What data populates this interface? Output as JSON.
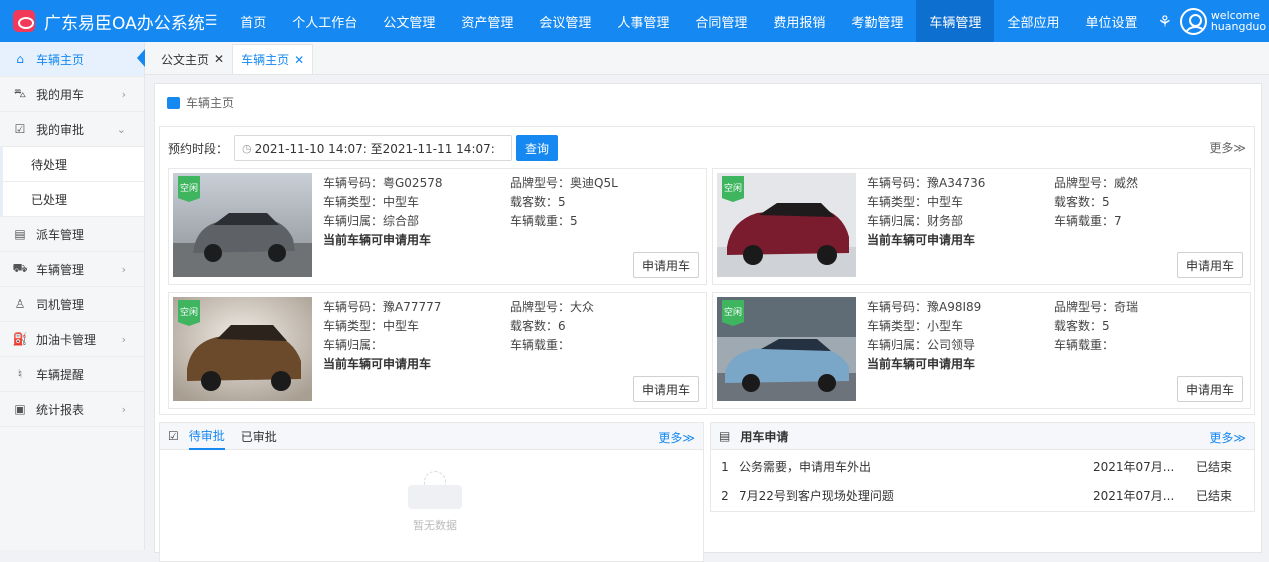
{
  "header": {
    "app_title": "广东易臣OA办公系统",
    "nav": [
      "首页",
      "个人工作台",
      "公文管理",
      "资产管理",
      "会议管理",
      "人事管理",
      "合同管理",
      "费用报销",
      "考勤管理",
      "车辆管理",
      "全部应用",
      "单位设置"
    ],
    "active_nav": "车辆管理",
    "user_line1": "welcome",
    "user_line2": "huangduo",
    "brand_color": "#1688f2"
  },
  "sidebar": {
    "items": [
      {
        "label": "车辆主页",
        "icon": "home-icon"
      },
      {
        "label": "我的用车",
        "icon": "car-icon"
      },
      {
        "label": "我的审批",
        "icon": "checkbox-icon"
      },
      {
        "label": "待处理"
      },
      {
        "label": "已处理"
      },
      {
        "label": "派车管理",
        "icon": "dispatch-icon"
      },
      {
        "label": "车辆管理",
        "icon": "car-manage-icon"
      },
      {
        "label": "司机管理",
        "icon": "driver-icon"
      },
      {
        "label": "加油卡管理",
        "icon": "fuel-card-icon"
      },
      {
        "label": "车辆提醒",
        "icon": "bell-icon"
      },
      {
        "label": "统计报表",
        "icon": "report-icon"
      }
    ]
  },
  "tabs": [
    {
      "label": "公文主页"
    },
    {
      "label": "车辆主页"
    }
  ],
  "breadcrumb": "车辆主页",
  "filter": {
    "label": "预约时段：",
    "date_range": "2021-11-10 14:07: 至2021-11-11 14:07:",
    "query_button": "查询",
    "more": "更多≫"
  },
  "cars": [
    {
      "badge": "空闲",
      "plate": "车辆号码：粤G02578",
      "brand": "品牌型号：奥迪Q5L",
      "type": "车辆类型：中型车",
      "seats": "载客数：5",
      "owner": "车辆归属：综合部",
      "load": "车辆载重：5",
      "status": "当前车辆可申请用车",
      "apply": "申请用车",
      "color": "#7a7c80"
    },
    {
      "badge": "空闲",
      "plate": "车辆号码：豫A34736",
      "brand": "品牌型号：威然",
      "type": "车辆类型：中型车",
      "seats": "载客数：5",
      "owner": "车辆归属：财务部",
      "load": "车辆载重：7",
      "status": "当前车辆可申请用车",
      "apply": "申请用车",
      "color": "#7b1b2e"
    },
    {
      "badge": "空闲",
      "plate": "车辆号码：豫A77777",
      "brand": "品牌型号：大众",
      "type": "车辆类型：中型车",
      "seats": "载客数：6",
      "owner": "车辆归属：",
      "load": "车辆载重：",
      "status": "当前车辆可申请用车",
      "apply": "申请用车",
      "color": "#6b4a2c"
    },
    {
      "badge": "空闲",
      "plate": "车辆号码：豫A98I89",
      "brand": "品牌型号：奇瑞",
      "type": "车辆类型：小型车",
      "seats": "载客数：5",
      "owner": "车辆归属：公司领导",
      "load": "车辆载重：",
      "status": "当前车辆可申请用车",
      "apply": "申请用车",
      "color": "#7aa6c8"
    }
  ],
  "approval": {
    "tabs": [
      "待审批",
      "已审批"
    ],
    "more": "更多≫",
    "empty": "暂无数据"
  },
  "applications": {
    "title": "用车申请",
    "more": "更多≫",
    "rows": [
      {
        "num": "1",
        "title": "公务需要，申请用车外出",
        "date": "2021年07月...",
        "status": "已结束"
      },
      {
        "num": "2",
        "title": "7月22号到客户现场处理问题",
        "date": "2021年07月...",
        "status": "已结束"
      }
    ]
  }
}
